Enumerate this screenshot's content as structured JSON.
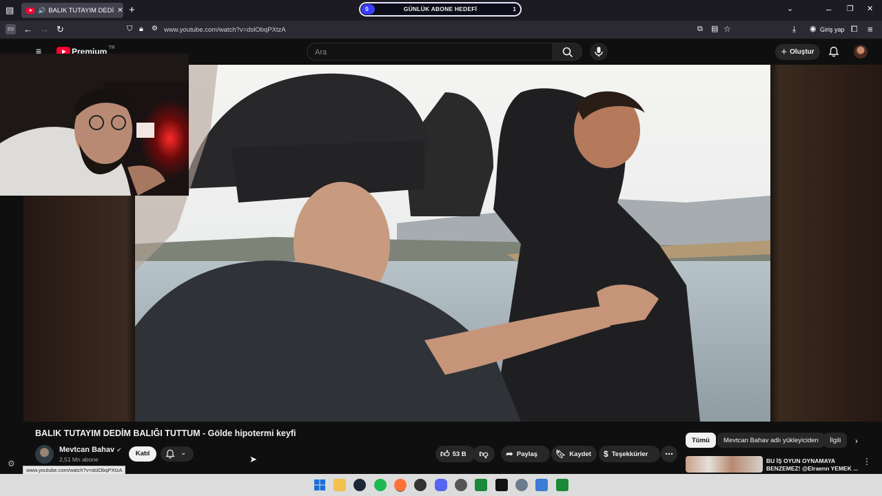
{
  "browser": {
    "tab_title": "BALIK TUTAYIM DEDİM BALIĞI TUTTUM - Gölde hipotermi keyfi",
    "tab_speaker": "🔊",
    "url": "www.youtube.com/watch?v=dslObqPXtzA",
    "signin_label": "Giriş yap"
  },
  "goal_widget": {
    "label": "GÜNLÜK ABONE HEDEFİ",
    "current": "0",
    "target": "1",
    "progress": 0.0,
    "accent": "#3a3cff"
  },
  "youtube": {
    "logo_text": "Premium",
    "region": "TR",
    "search_placeholder": "Ara",
    "create_label": "Oluştur"
  },
  "video": {
    "title": "BALIK TUTAYIM DEDİM BALIĞI TUTTUM - Gölde hipotermi keyfi",
    "channel": "Mevtcan Bahav",
    "subscribers": "2,51 Mn abone",
    "join_label": "Katıl",
    "like_count": "53 B",
    "share_label": "Paylaş",
    "save_label": "Kaydet",
    "thanks_label": "Teşekkürler"
  },
  "chips": [
    "Tümü",
    "Mevtcan Bahav adlı yükleyiciden",
    "İlgili"
  ],
  "recommendation": {
    "title": "BU İŞ OYUN OYNAMAYA BENZEMEZ! @Elraenn YEMEK ..."
  },
  "status_url": "www.youtube.com/watch?v=dslObqPXtzA"
}
